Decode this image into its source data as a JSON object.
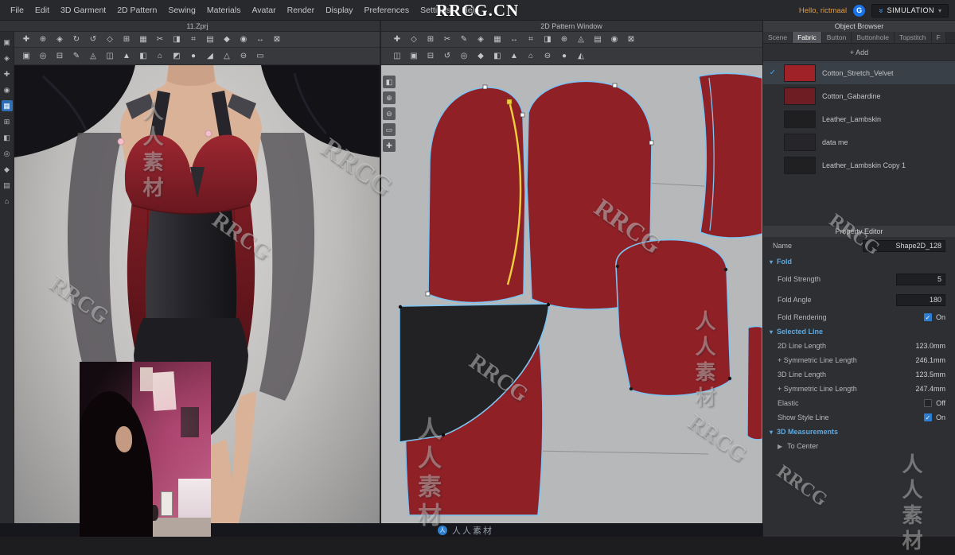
{
  "glyphs": {
    "check": "✓",
    "caret_down": "▾",
    "arrow_right": "▶",
    "chevrons": "»",
    "dropdown_caret": "▾"
  },
  "watermarks": {
    "brand_large": "RRCG.CN",
    "diagonal_text": "RRCG",
    "vertical_text": "人人素材"
  },
  "menu_bar": {
    "items": [
      "File",
      "Edit",
      "3D Garment",
      "2D Pattern",
      "Sewing",
      "Materials",
      "Avatar",
      "Render",
      "Display",
      "Preferences",
      "Settings",
      "Help"
    ],
    "greeting": "Hello, rictmaal",
    "logo_letter": "G",
    "simulation_label": "SIMULATION"
  },
  "window_titles": {
    "left": "11.Zprj",
    "right": "2D Pattern Window"
  },
  "toolbars": {
    "left_row1": [
      "✚",
      "⊕",
      "◈",
      "↻",
      "↺",
      "◇",
      "⊞",
      "▦",
      "✂",
      "◨",
      "⌗",
      "▤",
      "◆",
      "◉",
      "↔",
      "⊠"
    ],
    "left_row2": [
      "▣",
      "◎",
      "⊟",
      "✎",
      "◬",
      "◫",
      "▲",
      "◧",
      "⌂",
      "◩",
      "●",
      "◢",
      "△",
      "⊖",
      "▭"
    ],
    "right_row1": [
      "✚",
      "◇",
      "⊞",
      "✂",
      "✎",
      "◈",
      "▦",
      "↔",
      "⌗",
      "◨",
      "⊕",
      "◬",
      "▤",
      "◉",
      "⊠"
    ],
    "right_row2": [
      "◫",
      "▣",
      "⊟",
      "↺",
      "◎",
      "◆",
      "◧",
      "▲",
      "⌂",
      "⊖",
      "●",
      "◭"
    ],
    "side_rail": [
      "▣",
      "◈",
      "✚",
      "◉",
      "▦",
      "⊞",
      "◧",
      "◎",
      "◆",
      "▤",
      "⌂"
    ],
    "pattern_rail": [
      "◧",
      "⊕",
      "⊖",
      "▭",
      "✚"
    ]
  },
  "object_browser": {
    "title": "Object Browser",
    "tabs": [
      "Scene",
      "Fabric",
      "Button",
      "Buttonhole",
      "Topstitch",
      "F"
    ],
    "add_label": "+  Add",
    "fabrics": [
      {
        "name": "Cotton_Stretch_Velvet",
        "color": "#9e2228"
      },
      {
        "name": "Cotton_Gabardine",
        "color": "#6e1d22"
      },
      {
        "name": "Leather_Lambskin",
        "color": "#1f1f21"
      },
      {
        "name": "data me",
        "color": "#26262a"
      },
      {
        "name": "Leather_Lambskin Copy 1",
        "color": "#202023"
      }
    ]
  },
  "property_editor": {
    "title": "Property Editor",
    "name_label": "Name",
    "name_value": "Shape2D_128",
    "fold": {
      "section": "Fold",
      "strength_label": "Fold Strength",
      "strength_value": "5",
      "angle_label": "Fold Angle",
      "angle_value": "180",
      "rendering_label": "Fold Rendering",
      "rendering_value": "On"
    },
    "selected_line": {
      "section": "Selected Line",
      "rows": [
        {
          "label": "2D Line Length",
          "value": "123.0mm"
        },
        {
          "label": "+ Symmetric Line Length",
          "value": "246.1mm"
        },
        {
          "label": "3D Line Length",
          "value": "123.5mm"
        },
        {
          "label": "+ Symmetric Line Length",
          "value": "247.4mm"
        }
      ],
      "elastic_label": "Elastic",
      "elastic_value": "Off",
      "style_label": "Show Style Line",
      "style_value": "On"
    },
    "measurements": {
      "section": "3D Measurements",
      "to_center": "To Center"
    }
  },
  "bottom_bar": {
    "logo_glyph": "人",
    "logo_text": "人人素材"
  }
}
